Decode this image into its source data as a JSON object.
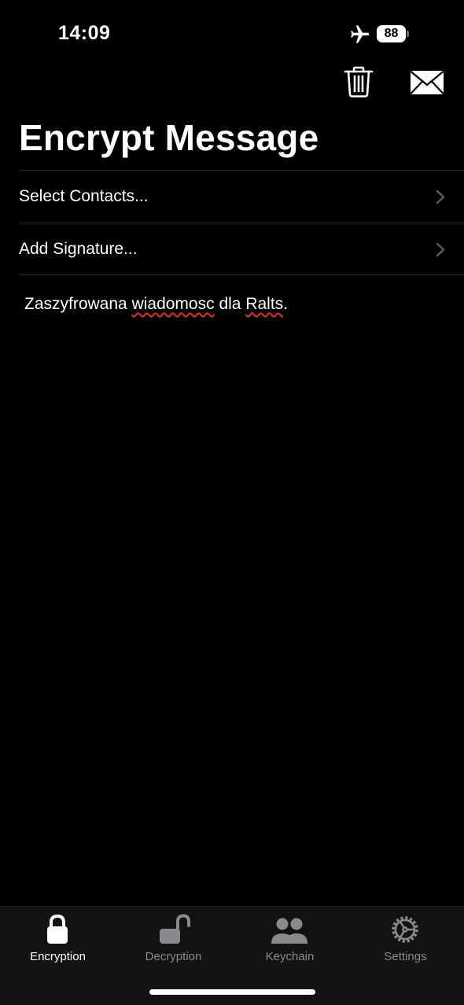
{
  "status_bar": {
    "time": "14:09",
    "battery_level": "88",
    "airplane_icon": "airplane-icon"
  },
  "nav": {
    "trash_icon": "trash-icon",
    "compose_icon": "mail-envelope-icon"
  },
  "page_title": "Encrypt Message",
  "rows": [
    {
      "label": "Select Contacts...",
      "icon": "chevron-right-icon"
    },
    {
      "label": "Add Signature...",
      "icon": "chevron-right-icon"
    }
  ],
  "message": {
    "words": [
      "Zaszyfrowana",
      "wiadomosc",
      "dla",
      "Ralts."
    ],
    "misspelled": [
      "wiadomosc",
      "Ralts"
    ]
  },
  "tab_bar": {
    "tabs": [
      {
        "label": "Encryption",
        "icon": "lock-closed-icon",
        "active": true
      },
      {
        "label": "Decryption",
        "icon": "lock-open-icon",
        "active": false
      },
      {
        "label": "Keychain",
        "icon": "people-icon",
        "active": false
      },
      {
        "label": "Settings",
        "icon": "gear-icon",
        "active": false
      }
    ]
  },
  "colors": {
    "background": "#000000",
    "tab_bar_bg": "#121212",
    "active_tab": "#ffffff",
    "inactive_tab": "#8a8a8e",
    "spellcheck_underline": "#e0322b"
  }
}
